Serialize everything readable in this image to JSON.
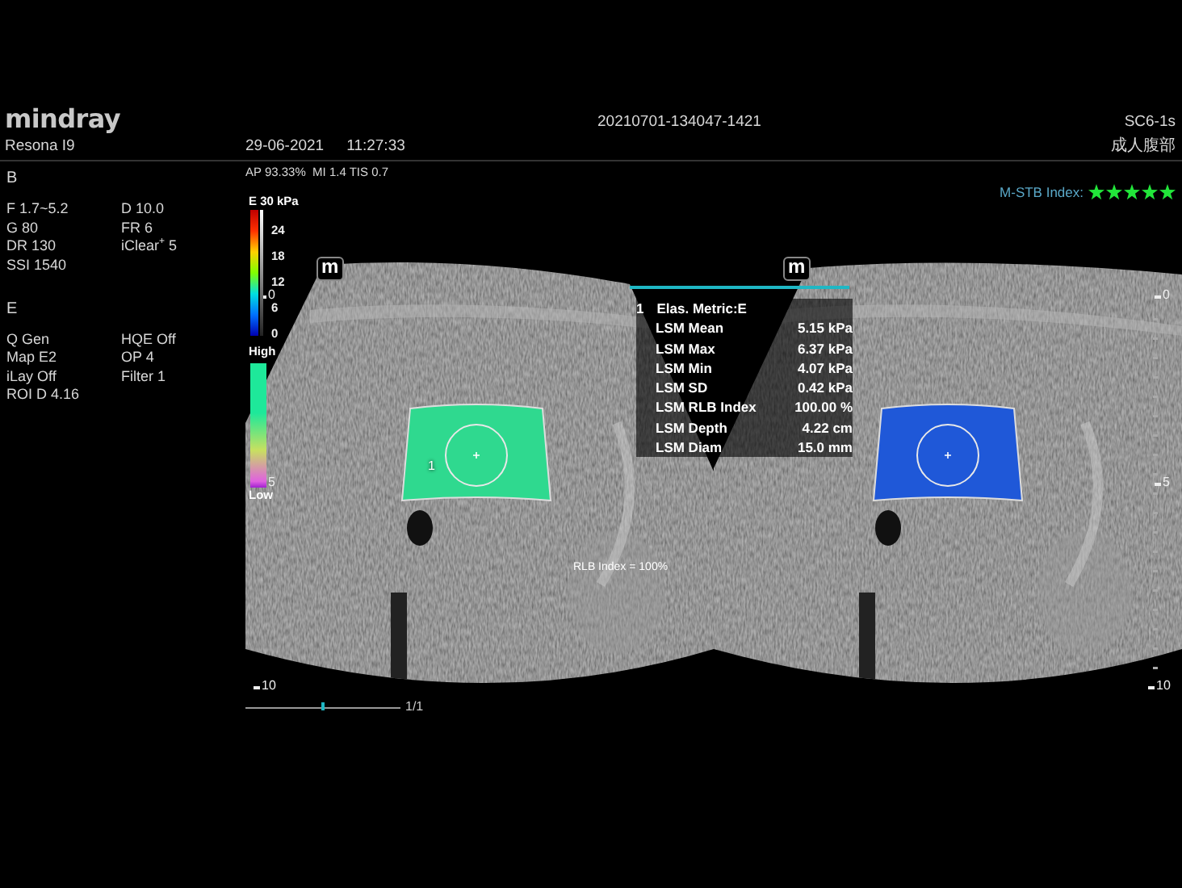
{
  "header": {
    "brand": "mindray",
    "exam_id": "20210701-134047-1421",
    "probe": "SC6-1s",
    "model": "Resona I9",
    "date": "29-06-2021",
    "time": "11:27:33",
    "preset": "成人腹部"
  },
  "params": [
    {
      "title": "B",
      "items": [
        "F 1.7~5.2",
        "D 10.0",
        "G 80",
        "FR 6",
        "DR 130",
        "iClear$^{+}$ 5",
        "SSI 1540"
      ]
    },
    {
      "title": "E",
      "items": [
        "Q Gen",
        "HQE Off",
        "Map E2",
        "OP 4",
        "iLay Off",
        "Filter 1",
        "ROI D 4.16"
      ]
    }
  ],
  "acoustic": "AP 93.33%  MI 1.4 TIS 0.7",
  "stability": {
    "label": "M-STB Index:",
    "stars": 5
  },
  "colorbar": {
    "title": "E 30 kPa",
    "ticks": [
      "24",
      "18",
      "12",
      "6",
      "0"
    ]
  },
  "quality_bar": {
    "high": "High",
    "low": "Low"
  },
  "images": [
    {
      "marker": "m",
      "roi_label": "1",
      "color": "#2fd98f",
      "depth_scale": [
        "0",
        "5",
        "10"
      ]
    },
    {
      "marker": "m",
      "color": "#1f58d8",
      "depth_scale": [
        "0",
        "5",
        "10"
      ]
    }
  ],
  "results": {
    "index": "1",
    "title": "Elas. Metric:E",
    "rows": [
      {
        "label": "LSM Mean",
        "value": "5.15 kPa"
      },
      {
        "label": "LSM Max",
        "value": "6.37 kPa"
      },
      {
        "label": "LSM Min",
        "value": "4.07 kPa"
      },
      {
        "label": "LSM SD",
        "value": "0.42 kPa"
      },
      {
        "label": "LSM RLB Index",
        "value": "100.00 %"
      },
      {
        "label": "LSM Depth",
        "value": "4.22 cm"
      },
      {
        "label": "LSM Diam",
        "value": "15.0 mm"
      }
    ]
  },
  "rlb_note": "RLB Index = 100%",
  "cine": {
    "counter": "1/1",
    "level": 0.5
  }
}
